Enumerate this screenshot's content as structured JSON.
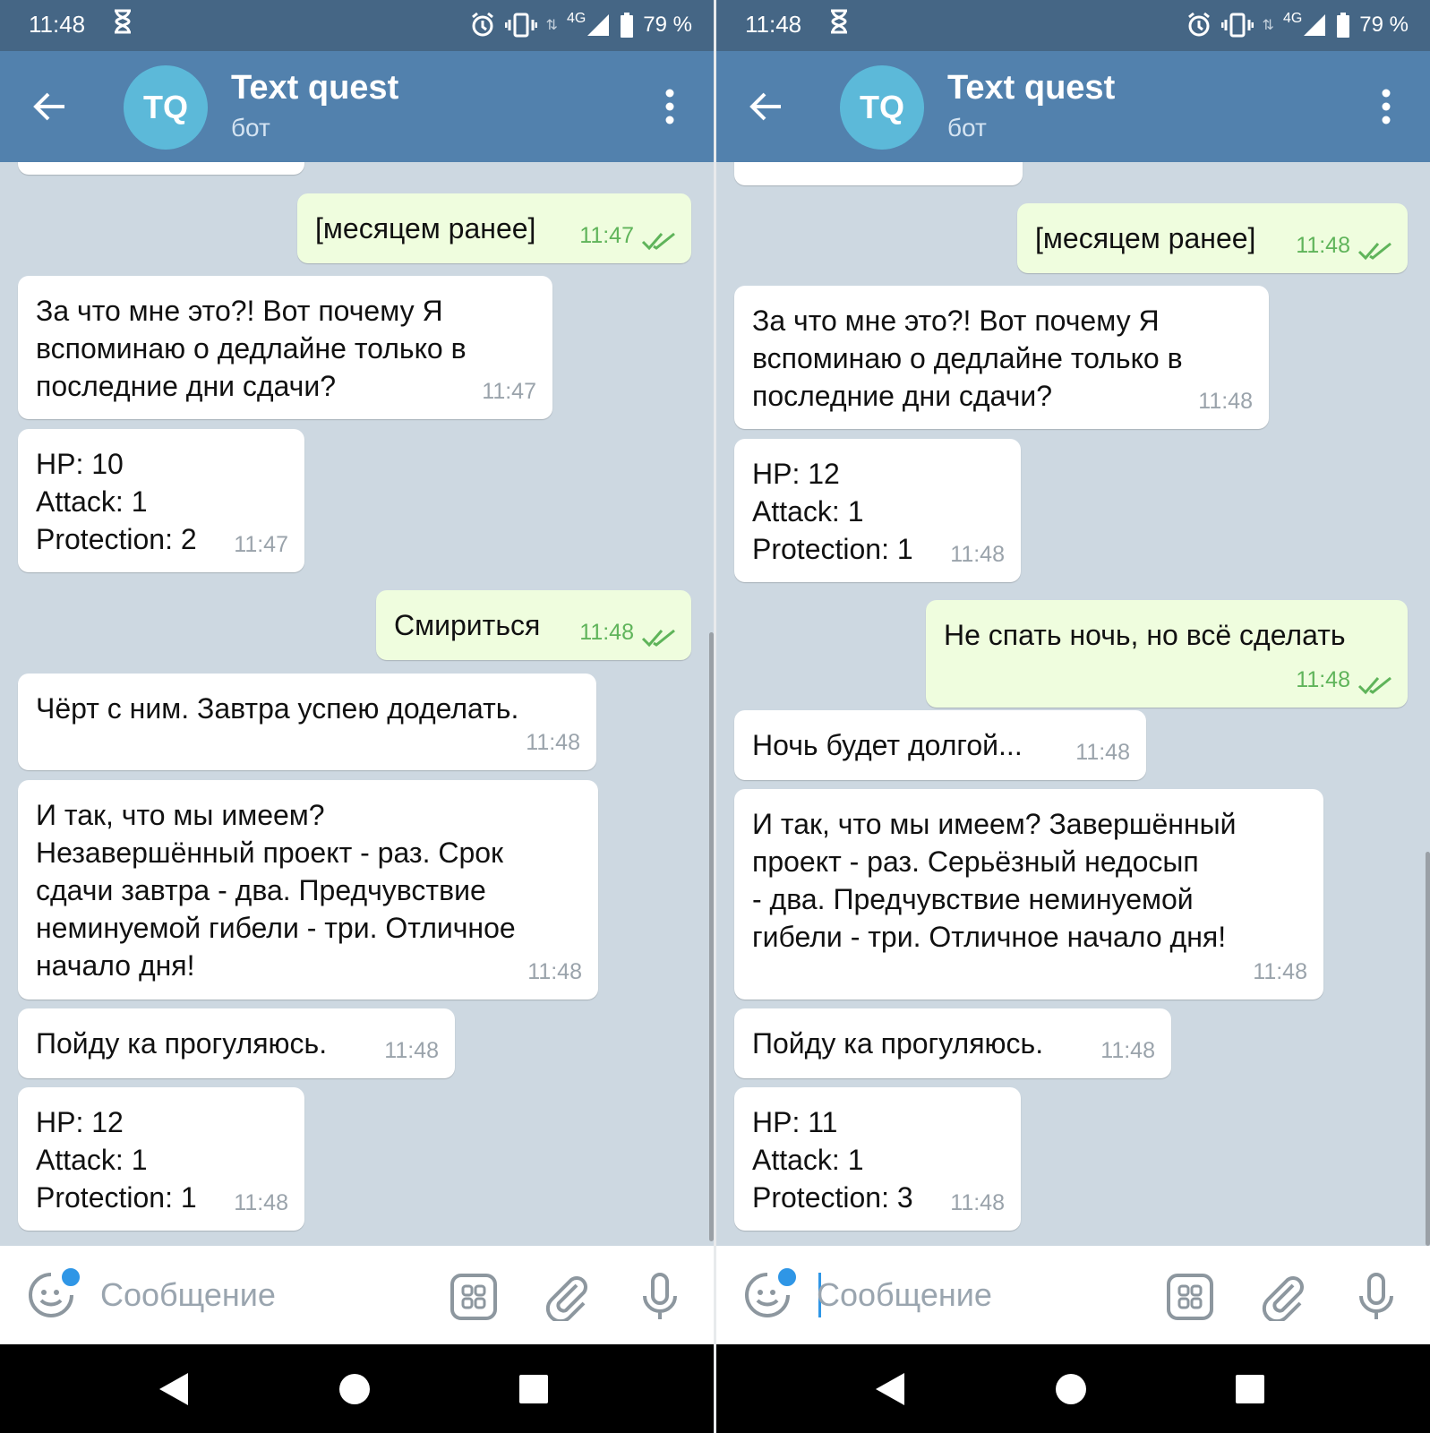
{
  "panels": [
    {
      "status": {
        "time": "11:48",
        "network": "4G",
        "battery": "79 %"
      },
      "header": {
        "avatar_initials": "TQ",
        "title": "Text quest",
        "subtitle": "бот"
      },
      "messages": [
        {
          "text": "[месяцем ранее]",
          "time": "11:47",
          "out": true
        },
        {
          "text": "За что мне это?! Вот почему Я\nвспоминаю о дедлайне только в\nпоследние дни сдачи?",
          "time": "11:47",
          "out": false
        },
        {
          "text": "HP: 10\nAttack: 1\nProtection: 2",
          "time": "11:47",
          "out": false
        },
        {
          "text": "Смириться",
          "time": "11:48",
          "out": true
        },
        {
          "text": "Чёрт с ним. Завтра успею доделать.",
          "time": "11:48",
          "out": false
        },
        {
          "text": "И так, что мы имеем?\nНезавершённый проект - раз. Срок\nсдачи завтра - два. Предчувствие\nнеминуемой гибели - три. Отличное\nначало дня!",
          "time": "11:48",
          "out": false
        },
        {
          "text": "Пойду ка прогуляюсь.",
          "time": "11:48",
          "out": false
        },
        {
          "text": "HP: 12\nAttack: 1\nProtection: 1",
          "time": "11:48",
          "out": false
        }
      ],
      "input": {
        "placeholder": "Сообщение"
      }
    },
    {
      "status": {
        "time": "11:48",
        "network": "4G",
        "battery": "79 %"
      },
      "header": {
        "avatar_initials": "TQ",
        "title": "Text quest",
        "subtitle": "бот"
      },
      "messages": [
        {
          "text": "[месяцем ранее]",
          "time": "11:48",
          "out": true
        },
        {
          "text": "За что мне это?! Вот почему Я\nвспоминаю о дедлайне только в\nпоследние дни сдачи?",
          "time": "11:48",
          "out": false
        },
        {
          "text": "HP: 12\nAttack: 1\nProtection: 1",
          "time": "11:48",
          "out": false
        },
        {
          "text": "Не спать ночь, но всё сделать",
          "time": "11:48",
          "out": true
        },
        {
          "text": "Ночь будет долгой...",
          "time": "11:48",
          "out": false
        },
        {
          "text": "И так, что мы имеем? Завершённый\nпроект - раз. Серьёзный недосып\n- два. Предчувствие неминуемой\nгибели - три. Отличное начало дня!",
          "time": "11:48",
          "out": false
        },
        {
          "text": "Пойду ка прогуляюсь.",
          "time": "11:48",
          "out": false
        },
        {
          "text": "HP: 11\nAttack: 1\nProtection: 3",
          "time": "11:48",
          "out": false
        }
      ],
      "input": {
        "placeholder": "Сообщение"
      }
    }
  ],
  "colors": {
    "header": "#5281ad",
    "statusbar": "#456685",
    "outgoing_bubble": "#effdde",
    "chat_background": "#cdd8e1",
    "accent": "#2f96e6"
  }
}
